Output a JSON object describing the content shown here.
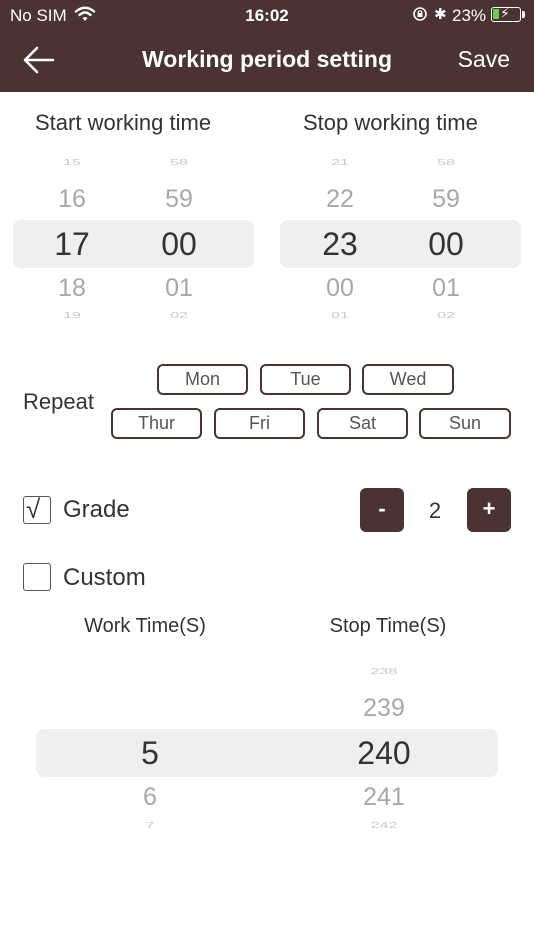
{
  "status_bar": {
    "carrier": "No SIM",
    "time": "16:02",
    "bluetooth": "✱",
    "battery_percent": "23%",
    "battery_bolt": "⚡"
  },
  "nav": {
    "title": "Working period setting",
    "save_label": "Save"
  },
  "start_time": {
    "label": "Start working time",
    "hour": {
      "far_above": "15",
      "above": "16",
      "selected": "17",
      "below": "18",
      "far_below": "19"
    },
    "minute": {
      "far_above": "58",
      "above": "59",
      "selected": "00",
      "below": "01",
      "far_below": "02"
    }
  },
  "stop_time": {
    "label": "Stop working time",
    "hour": {
      "far_above": "21",
      "above": "22",
      "selected": "23",
      "below": "00",
      "far_below": "01"
    },
    "minute": {
      "far_above": "58",
      "above": "59",
      "selected": "00",
      "below": "01",
      "far_below": "02"
    }
  },
  "repeat": {
    "label": "Repeat",
    "days": [
      "Mon",
      "Tue",
      "Wed",
      "Thur",
      "Fri",
      "Sat",
      "Sun"
    ]
  },
  "grade": {
    "label": "Grade",
    "checked": true,
    "check_mark": "√",
    "value": "2",
    "minus_label": "-",
    "plus_label": "+"
  },
  "custom": {
    "label": "Custom",
    "checked": false
  },
  "custom_times": {
    "work_header": "Work Time(S)",
    "stop_header": "Stop Time(S)",
    "work": {
      "selected": "5",
      "below": "6",
      "far_below": "7"
    },
    "stop": {
      "far_above": "238",
      "above": "239",
      "selected": "240",
      "below": "241",
      "far_below": "242"
    }
  },
  "colors": {
    "header_bg": "#4b3331",
    "accent": "#4b3331",
    "selection_band": "#efefef",
    "battery_fill": "#62d34a"
  }
}
